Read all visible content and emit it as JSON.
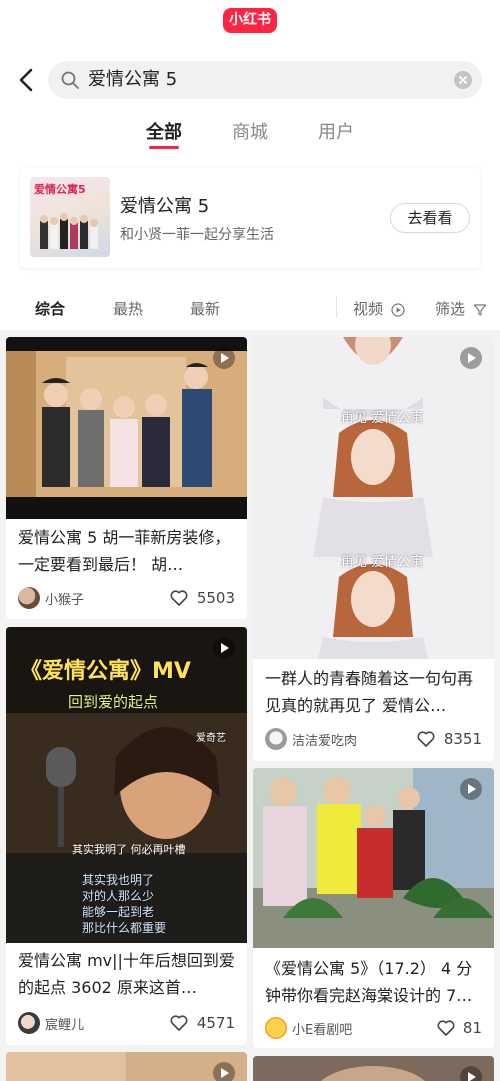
{
  "app": {
    "logo_text": "小红书"
  },
  "search": {
    "query": "爱情公寓 5"
  },
  "tabs": [
    {
      "label": "全部",
      "active": true
    },
    {
      "label": "商城",
      "active": false
    },
    {
      "label": "用户",
      "active": false
    }
  ],
  "feature": {
    "thumb_title": "爱情公寓5",
    "title": "爱情公寓 5",
    "subtitle": "和小贤一菲一起分享生活",
    "button": "去看看"
  },
  "filters": {
    "sort": [
      "综合",
      "最热",
      "最新"
    ],
    "video": "视频",
    "filter": "筛选"
  },
  "notes": [
    {
      "title": "爱情公寓 5 胡一菲新房装修，一定要看到最后！ 胡…",
      "author": "小猴子",
      "likes": "5503"
    },
    {
      "title": "一群人的青春随着这一句句再见真的就再见了 爱情公…",
      "author": "洁洁爱吃肉",
      "likes": "8351",
      "caption_1": "再见 爱情公寓",
      "caption_2": "再见 爱情公寓"
    },
    {
      "title": "爱情公寓 mv||十年后想回到爱的起点 3602 原来这首…",
      "author": "宸鲤儿",
      "likes": "4571",
      "overlay_title": "《爱情公寓》MV",
      "overlay_sub": "回到爱的起点",
      "overlay_brand": "爱奇艺",
      "lyric_1": "其实我明了 何必再叶槽",
      "lyric_2": "其实我也明了",
      "lyric_3": "对的人那么少",
      "lyric_4": "能够一起到老",
      "lyric_5": "那比什么都重要"
    },
    {
      "title": "《爱情公寓 5》（17.2） 4 分钟带你看完赵海棠设计的 7…",
      "author": "小E看剧吧",
      "likes": "81"
    }
  ],
  "colors": {
    "brand_red": "#ff2442"
  }
}
